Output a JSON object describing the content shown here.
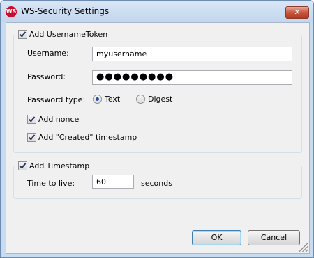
{
  "window": {
    "title": "WS-Security Settings",
    "app_icon_text": "WS",
    "close_label": "✕"
  },
  "username_token": {
    "label": "Add UsernameToken",
    "checked": true,
    "username_label": "Username:",
    "username_value": "myusername",
    "password_label": "Password:",
    "password_value": "●●●●●●●●●",
    "password_type_label": "Password type:",
    "type_options": [
      "Text",
      "Digest"
    ],
    "type_selected": "Text",
    "nonce_label": "Add nonce",
    "nonce_checked": true,
    "created_label": "Add \"Created\" timestamp",
    "created_checked": true
  },
  "timestamp": {
    "label": "Add Timestamp",
    "checked": true,
    "ttl_label": "Time to live:",
    "ttl_value": "60",
    "ttl_unit": "seconds"
  },
  "buttons": {
    "ok": "OK",
    "cancel": "Cancel"
  }
}
